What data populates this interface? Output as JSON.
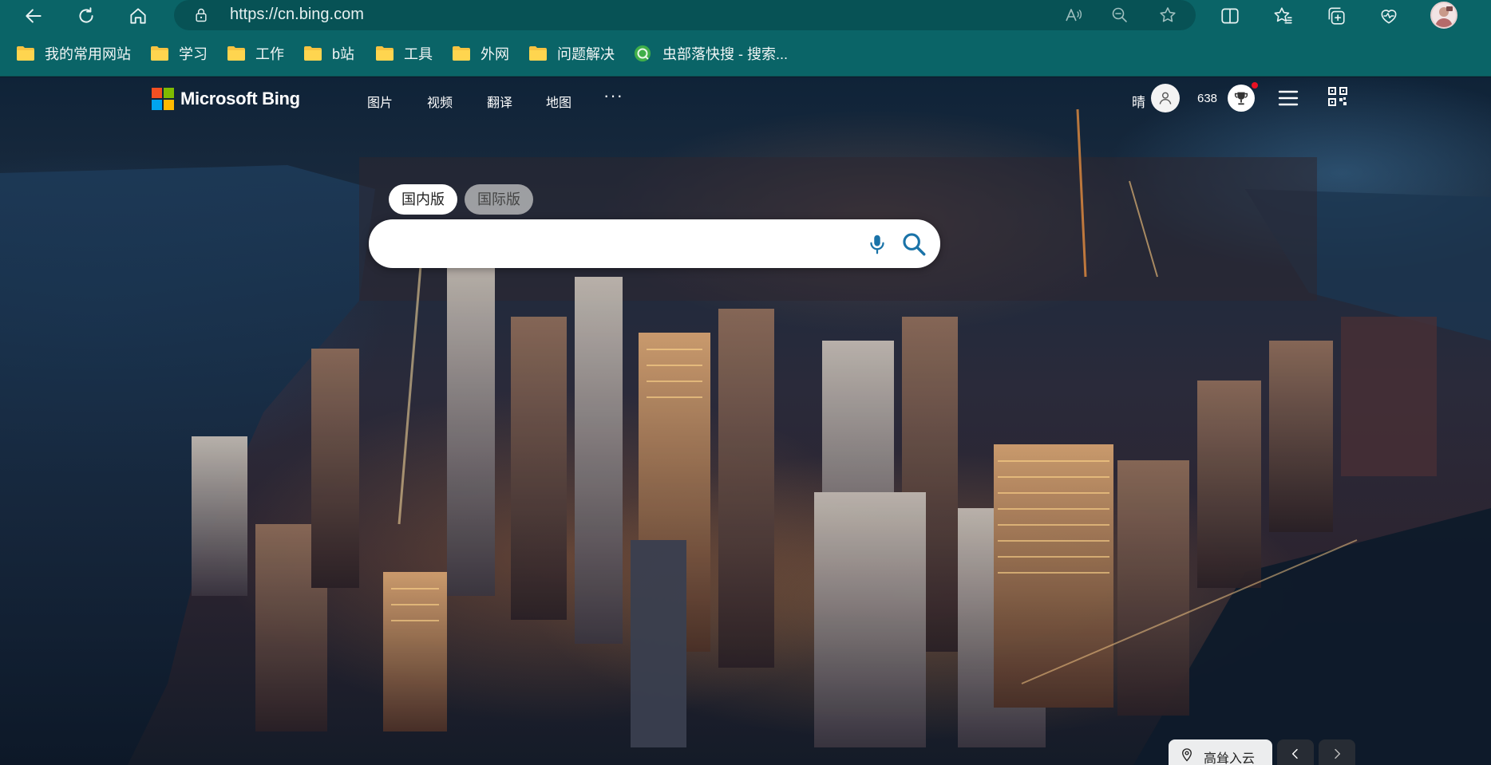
{
  "browser": {
    "url": "https://cn.bing.com",
    "bookmarks": [
      {
        "label": "我的常用网站",
        "type": "folder"
      },
      {
        "label": "学习",
        "type": "folder"
      },
      {
        "label": "工作",
        "type": "folder"
      },
      {
        "label": "b站",
        "type": "folder"
      },
      {
        "label": "工具",
        "type": "folder"
      },
      {
        "label": "外网",
        "type": "folder"
      },
      {
        "label": "问题解决",
        "type": "folder"
      },
      {
        "label": "虫部落快搜 - 搜索...",
        "type": "site"
      }
    ],
    "toolbar_icons": [
      "back-icon",
      "refresh-icon",
      "home-icon",
      "lock-icon",
      "read-aloud-icon",
      "zoom-out-icon",
      "favorite-star-icon",
      "split-screen-icon",
      "favorites-icon",
      "collections-icon",
      "browser-essentials-icon",
      "profile-avatar"
    ]
  },
  "bing": {
    "logo_text": "Microsoft Bing",
    "nav": [
      "图片",
      "视频",
      "翻译",
      "地图"
    ],
    "more": "···",
    "weather": "晴",
    "points": "638",
    "tabs": {
      "domestic": "国内版",
      "international": "国际版"
    },
    "search": {
      "value": "",
      "placeholder": ""
    },
    "location": "高耸入云"
  },
  "colors": {
    "browser_chrome": "#0a6467",
    "address_bar": "#075255",
    "ms_red": "#f25022",
    "ms_green": "#7fba00",
    "ms_blue": "#00a4ef",
    "ms_yellow": "#ffb900",
    "search_icon": "#1a73a8",
    "notification_dot": "#e81123"
  }
}
